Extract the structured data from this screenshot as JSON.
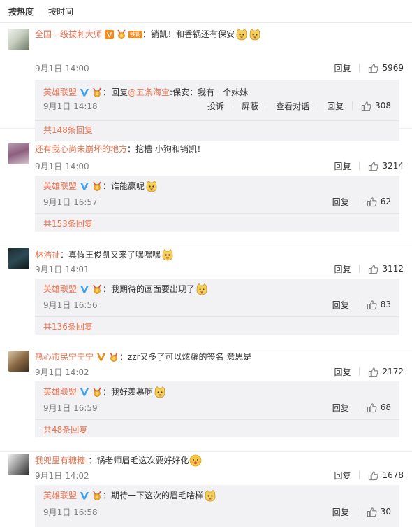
{
  "sort": {
    "hot": "按热度",
    "time": "按时间"
  },
  "comments": [
    {
      "user": "全国一级拔刺大师",
      "fan_tag": "铁粉",
      "text": "：销凯！和香锅还有保安",
      "time": "9月1日 14:00",
      "reply_label": "回复",
      "likes": "5969",
      "reply": {
        "user": "英雄联盟",
        "prefix": "：回复",
        "mention": "@五条海宝",
        "text": ":保安：我有一个妹妹",
        "time": "9月1日 14:18",
        "actions": [
          "投诉",
          "屏蔽",
          "查看对话",
          "回复"
        ],
        "likes": "308"
      },
      "more": "共148条回复"
    },
    {
      "user": "还有我心尚未崩坏的地方",
      "text": "：挖槽 小狗和销凯！",
      "time": "9月1日 14:00",
      "reply_label": "回复",
      "likes": "3214",
      "reply": {
        "user": "英雄联盟",
        "text": "：谁能赢呢",
        "time": "9月1日 16:57",
        "reply_label": "回复",
        "likes": "62"
      },
      "more": "共153条回复"
    },
    {
      "user": "林浩祉",
      "text": "：真假王俊凯又来了嘿嘿嘿",
      "time": "9月1日 14:01",
      "reply_label": "回复",
      "likes": "3112",
      "reply": {
        "user": "英雄联盟",
        "text": "：我期待的画面要出现了",
        "time": "9月1日 16:56",
        "reply_label": "回复",
        "likes": "83"
      },
      "more": "共136条回复"
    },
    {
      "user": "热心市民宁宁宁",
      "text": "：zzr又多了可以炫耀的签名 意思是",
      "time": "9月1日 14:02",
      "reply_label": "回复",
      "likes": "2172",
      "reply": {
        "user": "英雄联盟",
        "text": "：我好羡慕啊",
        "time": "9月1日 16:59",
        "reply_label": "回复",
        "likes": "68"
      },
      "more": "共48条回复"
    },
    {
      "user": "我兜里有糖糖-",
      "text": "：锅老师眉毛这次要好好化",
      "time": "9月1日 14:02",
      "reply_label": "回复",
      "likes": "1678",
      "reply": {
        "user": "英雄联盟",
        "text": "：期待一下这次的眉毛啥样",
        "time": "9月1日 16:58",
        "reply_label": "回复",
        "likes": "30"
      }
    }
  ],
  "colors": {
    "username": "#eb7350",
    "reply_bg": "#f2f2f5",
    "verified_blue": "#3aa1f3",
    "verified_orange": "#f78a1f"
  }
}
